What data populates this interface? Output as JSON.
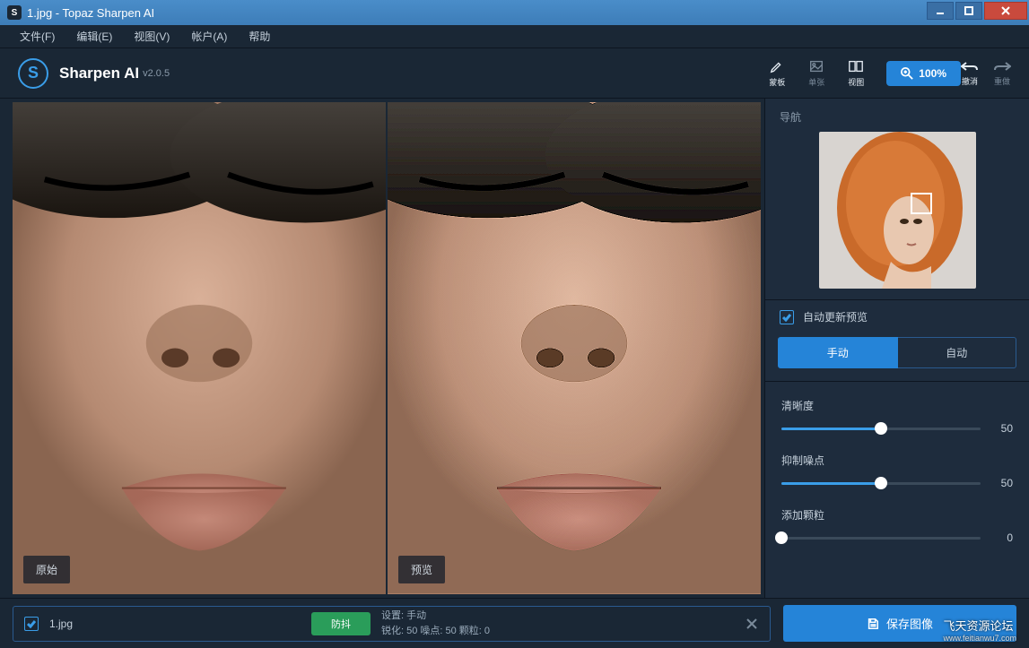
{
  "window": {
    "title": "1.jpg - Topaz Sharpen AI"
  },
  "menu": {
    "file": "文件(F)",
    "edit": "编辑(E)",
    "view": "视图(V)",
    "account": "帐户(A)",
    "help": "帮助"
  },
  "app": {
    "name": "Sharpen AI",
    "version": "v2.0.5"
  },
  "toolbar": {
    "mask": "蒙板",
    "single": "单张",
    "compare": "视图",
    "zoom": "100%",
    "undo": "撤消",
    "redo": "重做"
  },
  "preview": {
    "original": "原始",
    "result": "预览"
  },
  "sidebar": {
    "nav": "导航",
    "auto_update": "自动更新预览",
    "mode_manual": "手动",
    "mode_auto": "自动",
    "sliders": [
      {
        "label": "清晰度",
        "value": 50,
        "pct": 50
      },
      {
        "label": "抑制噪点",
        "value": 50,
        "pct": 50
      },
      {
        "label": "添加颗粒",
        "value": 0,
        "pct": 0
      }
    ]
  },
  "bottom": {
    "filename": "1.jpg",
    "mode_badge": "防抖",
    "settings_label": "设置: 手动",
    "settings_vals": "锐化: 50  噪点: 50  颗粒: 0",
    "save": "保存图像"
  },
  "watermark": {
    "main": "飞天资源论坛",
    "sub": "www.feitianwu7.com"
  }
}
